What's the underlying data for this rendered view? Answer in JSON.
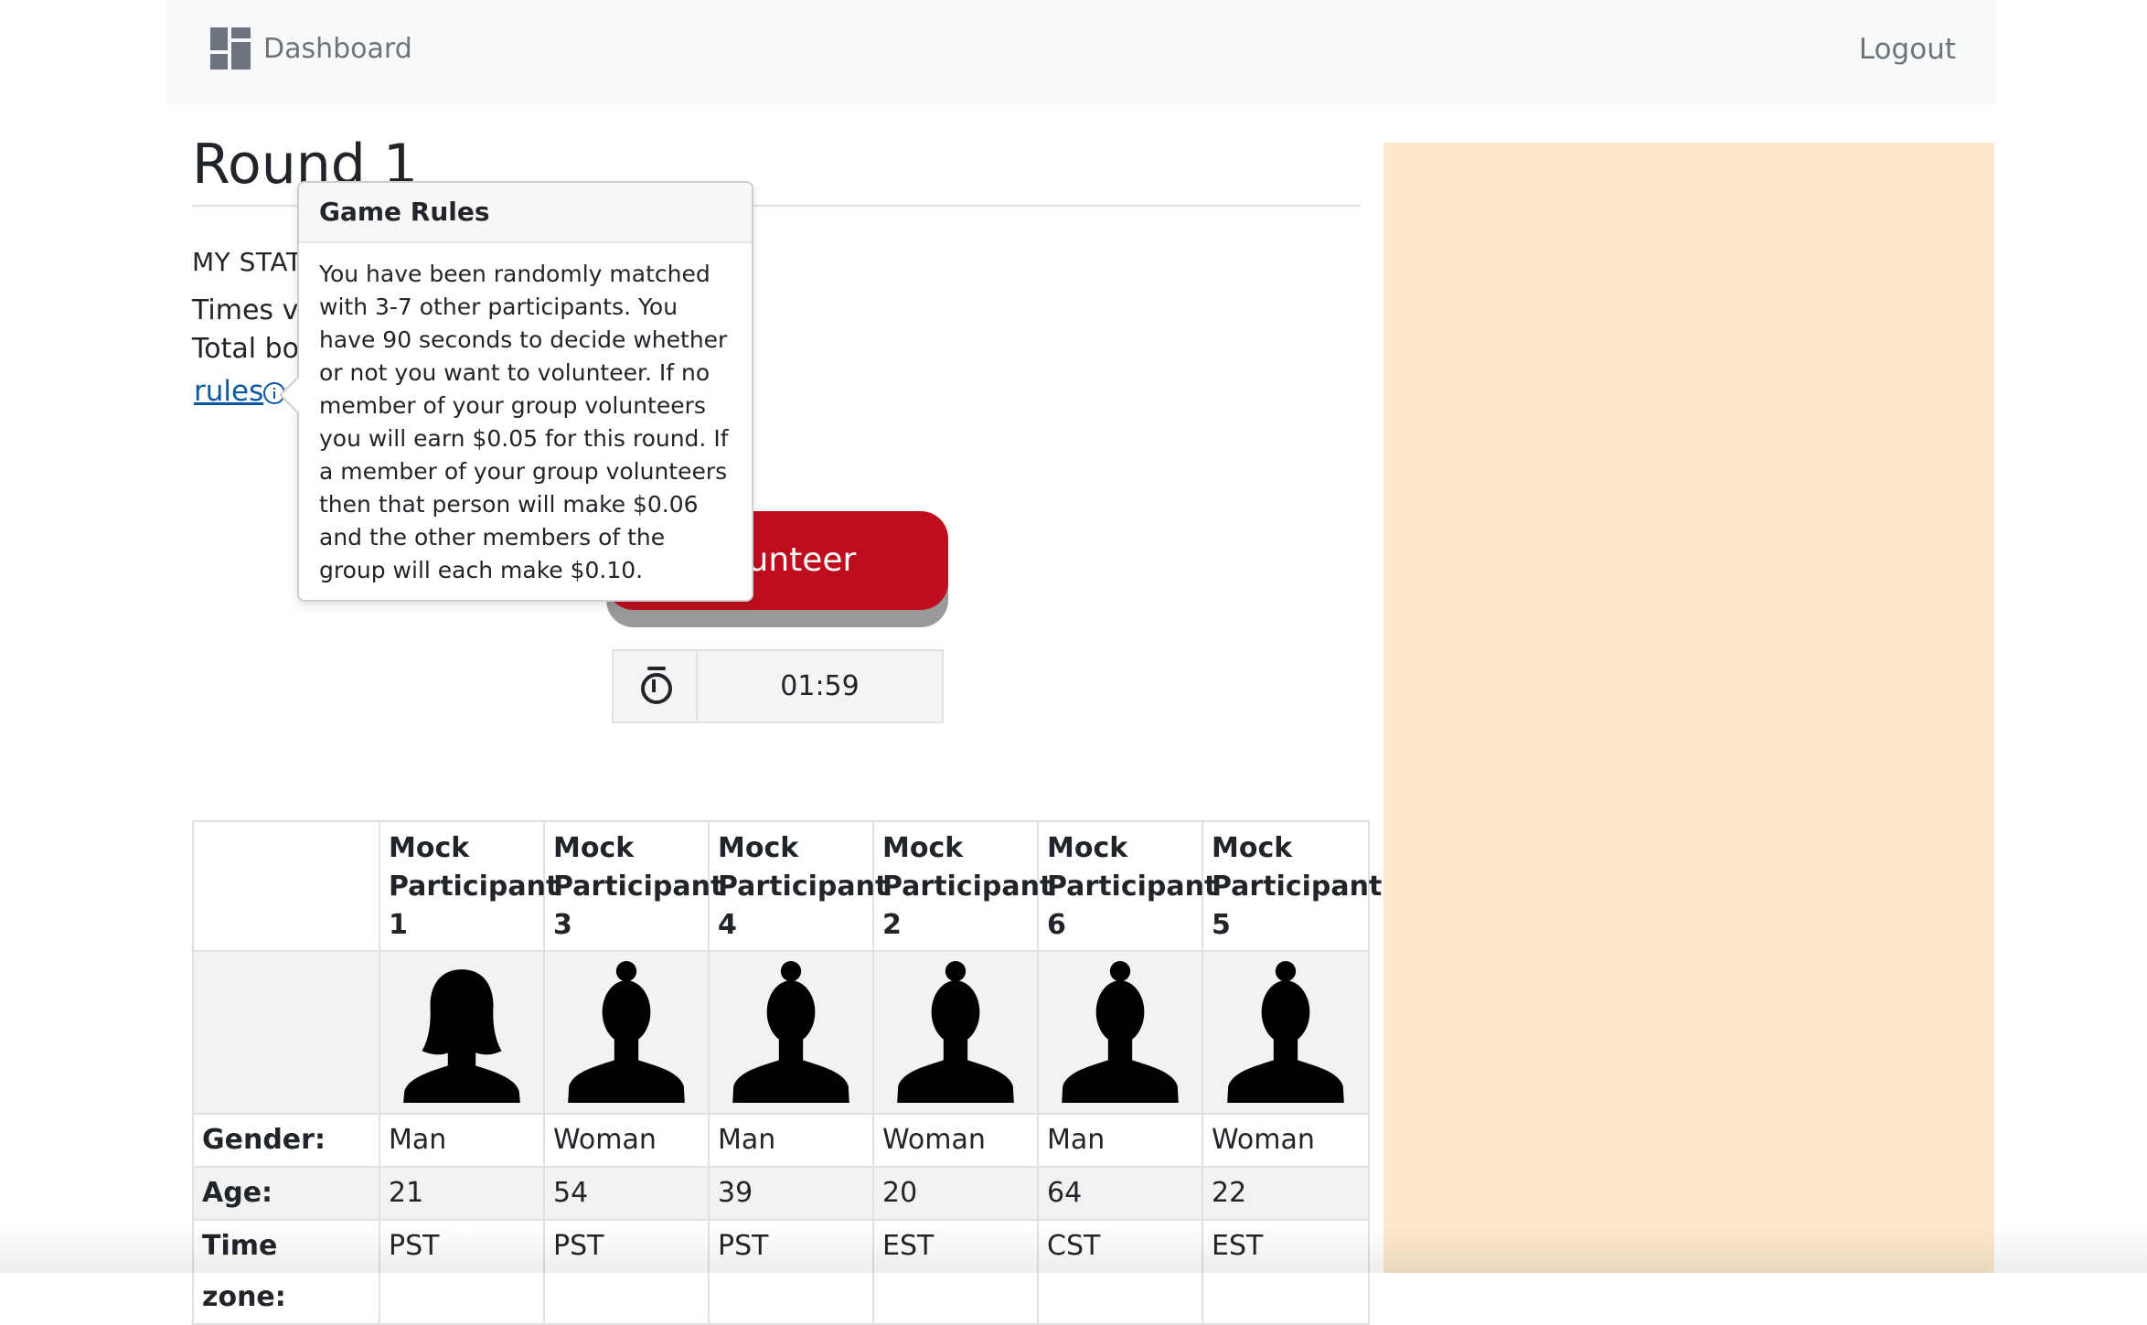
{
  "navbar": {
    "brand_label": "Dashboard",
    "logout_label": "Logout",
    "brand_icon": "dashboard-grid-icon"
  },
  "main": {
    "round_title": "Round 1",
    "stats_heading": "MY STAT",
    "times_voted_label": "Times vo",
    "total_bonus_label": "Total bo",
    "rules_link": "rules",
    "volunteer_label": "Volunteer",
    "timer_value": "01:59"
  },
  "popover": {
    "title": "Game Rules",
    "body": "You have been randomly matched with 3-7 other participants. You have 90 seconds to decide whether or not you want to volunteer. If no member of your group volunteers you will earn $0.05 for this round. If a member of your group volunteers then that person will make $0.06 and the other members of the group will each make $0.10."
  },
  "table": {
    "participants": [
      {
        "name": "Mock Participant 1",
        "gender": "Man",
        "age": "21",
        "timezone": "PST",
        "avatar": "female-silhouette-long-hair"
      },
      {
        "name": "Mock Participant 3",
        "gender": "Woman",
        "age": "54",
        "timezone": "PST",
        "avatar": "female-silhouette-bun"
      },
      {
        "name": "Mock Participant 4",
        "gender": "Man",
        "age": "39",
        "timezone": "PST",
        "avatar": "female-silhouette-bun"
      },
      {
        "name": "Mock Participant 2",
        "gender": "Woman",
        "age": "20",
        "timezone": "EST",
        "avatar": "female-silhouette-bun"
      },
      {
        "name": "Mock Participant 6",
        "gender": "Man",
        "age": "64",
        "timezone": "CST",
        "avatar": "female-silhouette-bun"
      },
      {
        "name": "Mock Participant 5",
        "gender": "Woman",
        "age": "22",
        "timezone": "EST",
        "avatar": "female-silhouette-bun"
      }
    ],
    "row_labels": {
      "gender": "Gender:",
      "age": "Age:",
      "timezone": "Time zone:"
    }
  },
  "colors": {
    "navbar_bg": "#f8f9fa",
    "side_panel": "#fde8cc",
    "volunteer_button": "#be0e1e",
    "link": "#0b57a4"
  }
}
